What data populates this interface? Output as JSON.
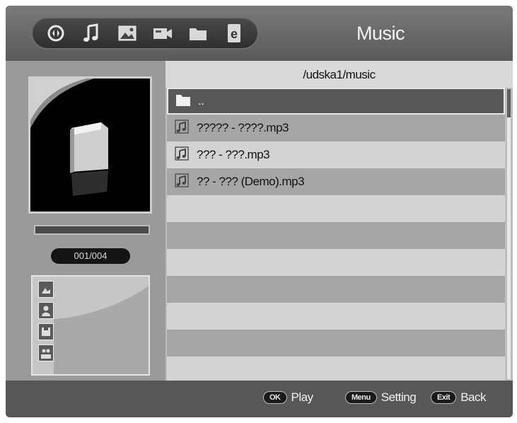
{
  "header": {
    "title": "Music",
    "icons": [
      "play-circle-icon",
      "music-note-icon",
      "photo-icon",
      "video-icon",
      "folder-icon",
      "document-e-icon"
    ],
    "e_glyph": "e"
  },
  "left": {
    "counter": "001/004",
    "progress": 0
  },
  "browser": {
    "path": "/udska1/music",
    "rows": [
      {
        "icon": "folder-icon",
        "name": "..",
        "selected": true
      },
      {
        "icon": "audio-file-icon",
        "name": "????? - ????.mp3"
      },
      {
        "icon": "audio-file-icon",
        "name": "??? - ???.mp3"
      },
      {
        "icon": "audio-file-icon",
        "name": "?? - ??? (Demo).mp3"
      }
    ]
  },
  "footer": {
    "ok_key": "OK",
    "ok_label": "Play",
    "menu_key": "Menu",
    "menu_label": "Setting",
    "exit_key": "Exit",
    "exit_label": "Back"
  }
}
